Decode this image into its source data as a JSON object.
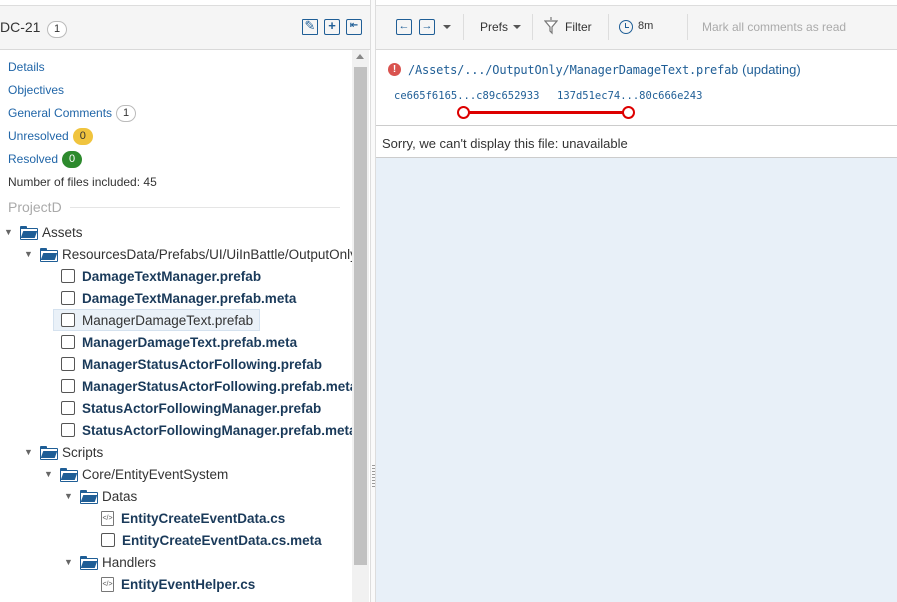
{
  "review": {
    "id": "DC-21",
    "count": "1"
  },
  "nav": {
    "details": "Details",
    "objectives": "Objectives",
    "general_comments": "General Comments",
    "general_comments_count": "1",
    "unresolved": "Unresolved",
    "unresolved_count": "0",
    "resolved": "Resolved",
    "resolved_count": "0",
    "files_included": "Number of files included: 45"
  },
  "project": "ProjectD",
  "tree": {
    "assets": "Assets",
    "resources_path": "ResourcesData/Prefabs/UI/UiInBattle/OutputOnly",
    "files1": [
      "DamageTextManager.prefab",
      "DamageTextManager.prefab.meta",
      "ManagerDamageText.prefab",
      "ManagerDamageText.prefab.meta",
      "ManagerStatusActorFollowing.prefab",
      "ManagerStatusActorFollowing.prefab.meta",
      "StatusActorFollowingManager.prefab",
      "StatusActorFollowingManager.prefab.meta"
    ],
    "scripts": "Scripts",
    "core": "Core/EntityEventSystem",
    "datas": "Datas",
    "datas_files": [
      "EntityCreateEventData.cs",
      "EntityCreateEventData.cs.meta"
    ],
    "handlers": "Handlers",
    "handlers_files": [
      "EntityEventHelper.cs"
    ]
  },
  "toolbar": {
    "prefs": "Prefs",
    "filter": "Filter",
    "time": "8m",
    "mark_all": "Mark all comments as read"
  },
  "file": {
    "path": "/Assets/.../OutputOnly/ManagerDamageText.prefab",
    "status": "(updating)",
    "rev_from": "ce665f6165...c89c652933",
    "rev_to": "137d51ec74...80c666e243",
    "message": "Sorry, we can't display this file: unavailable"
  },
  "colors": {
    "accent": "#1f5e96",
    "error": "#dd0000",
    "unresolved": "#f0c43e",
    "resolved": "#2d8a2d"
  }
}
